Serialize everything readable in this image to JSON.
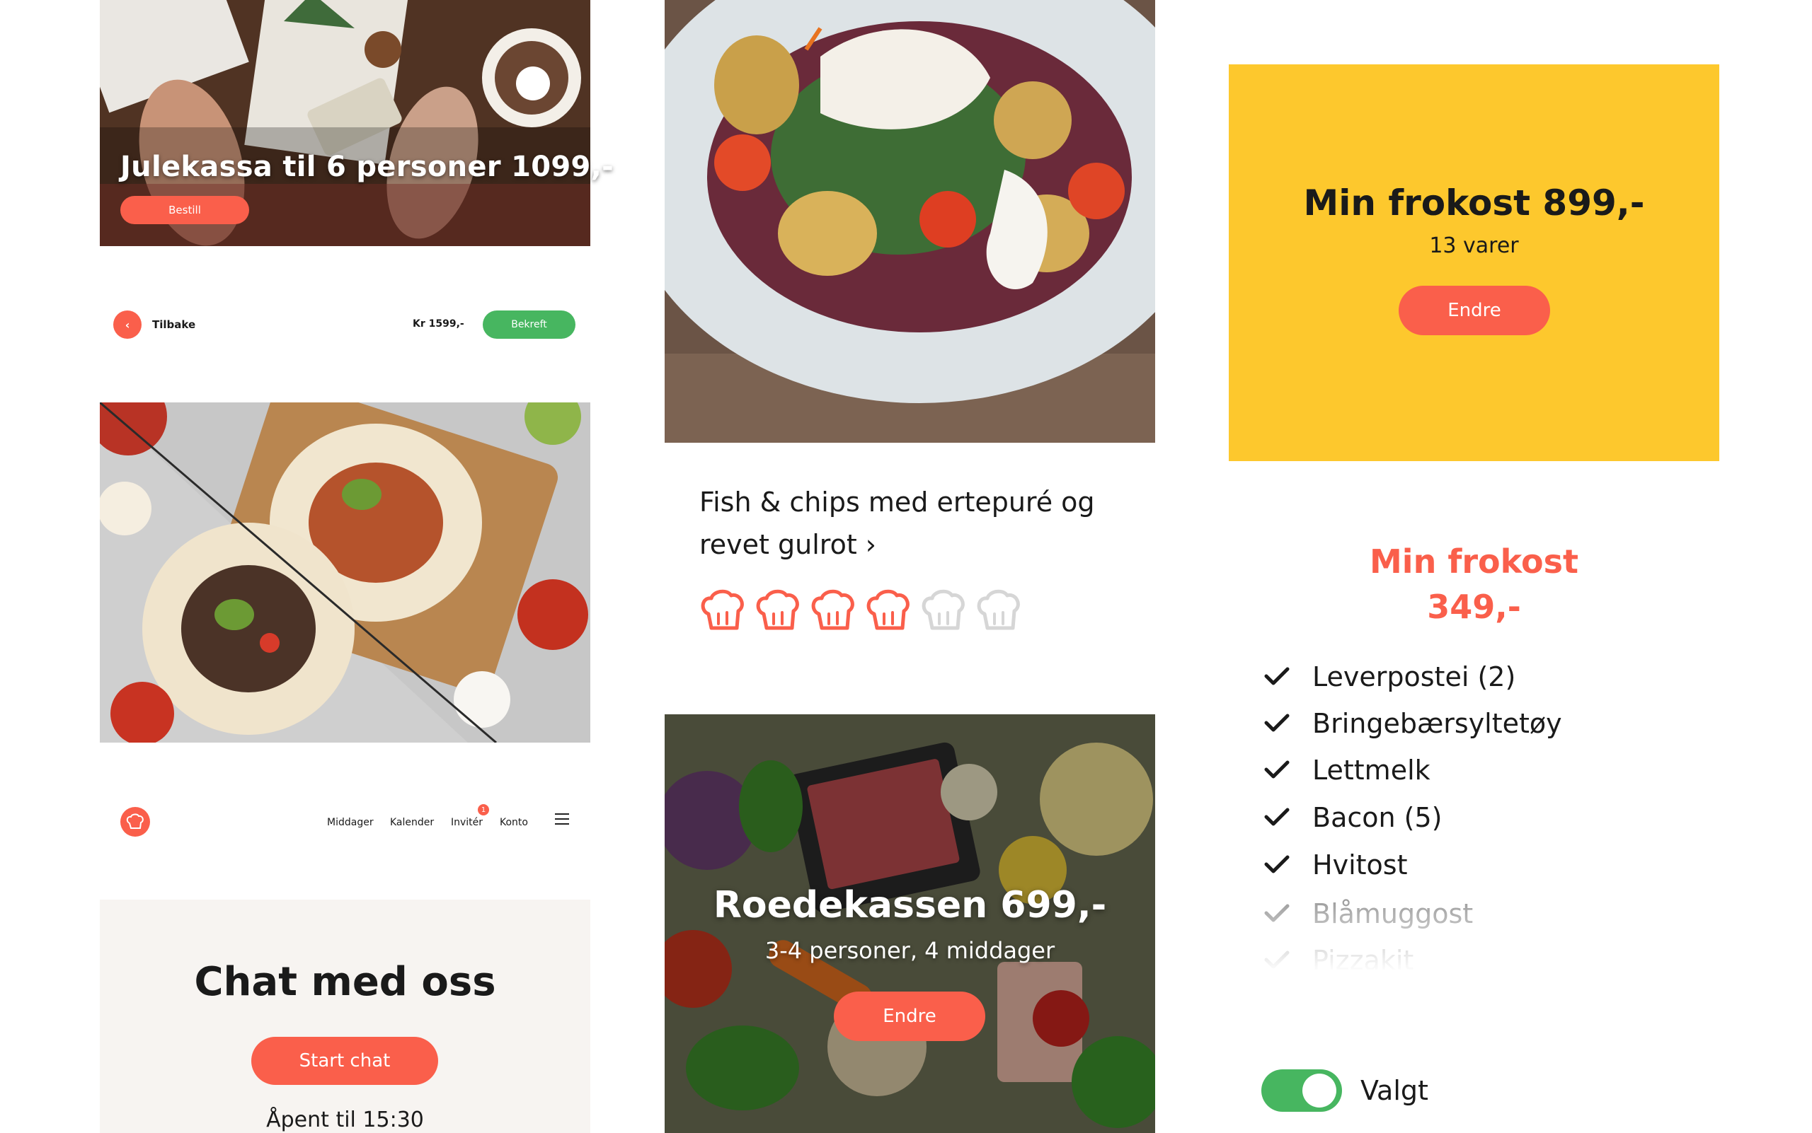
{
  "julekassa": {
    "title": "Julekassa til 6 personer 1099,-",
    "button": "Bestill"
  },
  "checkout_bar": {
    "back_label": "Tilbake",
    "price": "Kr 1599,-",
    "confirm_label": "Bekreft"
  },
  "nav": {
    "items": [
      "Middager",
      "Kalender",
      "Invitér",
      "Konto"
    ],
    "badge_count": "1"
  },
  "chat": {
    "title": "Chat med oss",
    "button": "Start chat",
    "open_hours": "Åpent til 15:30"
  },
  "recipe": {
    "title": "Fish & chips med ertepuré og revet gulrot ›",
    "difficulty": {
      "filled": 4,
      "total": 6
    }
  },
  "roede": {
    "title": "Roedekassen 699,-",
    "subtitle": "3-4 personer, 4 middager",
    "button": "Endre"
  },
  "frokost_card": {
    "title": "Min frokost 899,-",
    "subtitle": "13 varer",
    "button": "Endre"
  },
  "shopping_list": {
    "title_line1": "Min frokost",
    "title_line2": "349,-",
    "items": [
      {
        "label": "Leverpostei (2)",
        "checked": true
      },
      {
        "label": "Bringebærsyltetøy",
        "checked": true
      },
      {
        "label": "Lettmelk",
        "checked": true
      },
      {
        "label": "Bacon (5)",
        "checked": true
      },
      {
        "label": "Hvitost",
        "checked": true
      },
      {
        "label": "Blåmuggost",
        "checked": false
      },
      {
        "label": "Pizzakit",
        "checked": false
      }
    ]
  },
  "toggle": {
    "label": "Valgt",
    "on": true
  },
  "colors": {
    "accent": "#fa5f4b",
    "green": "#47b660",
    "yellow": "#fdc82d",
    "cream": "#f7f4f1"
  }
}
